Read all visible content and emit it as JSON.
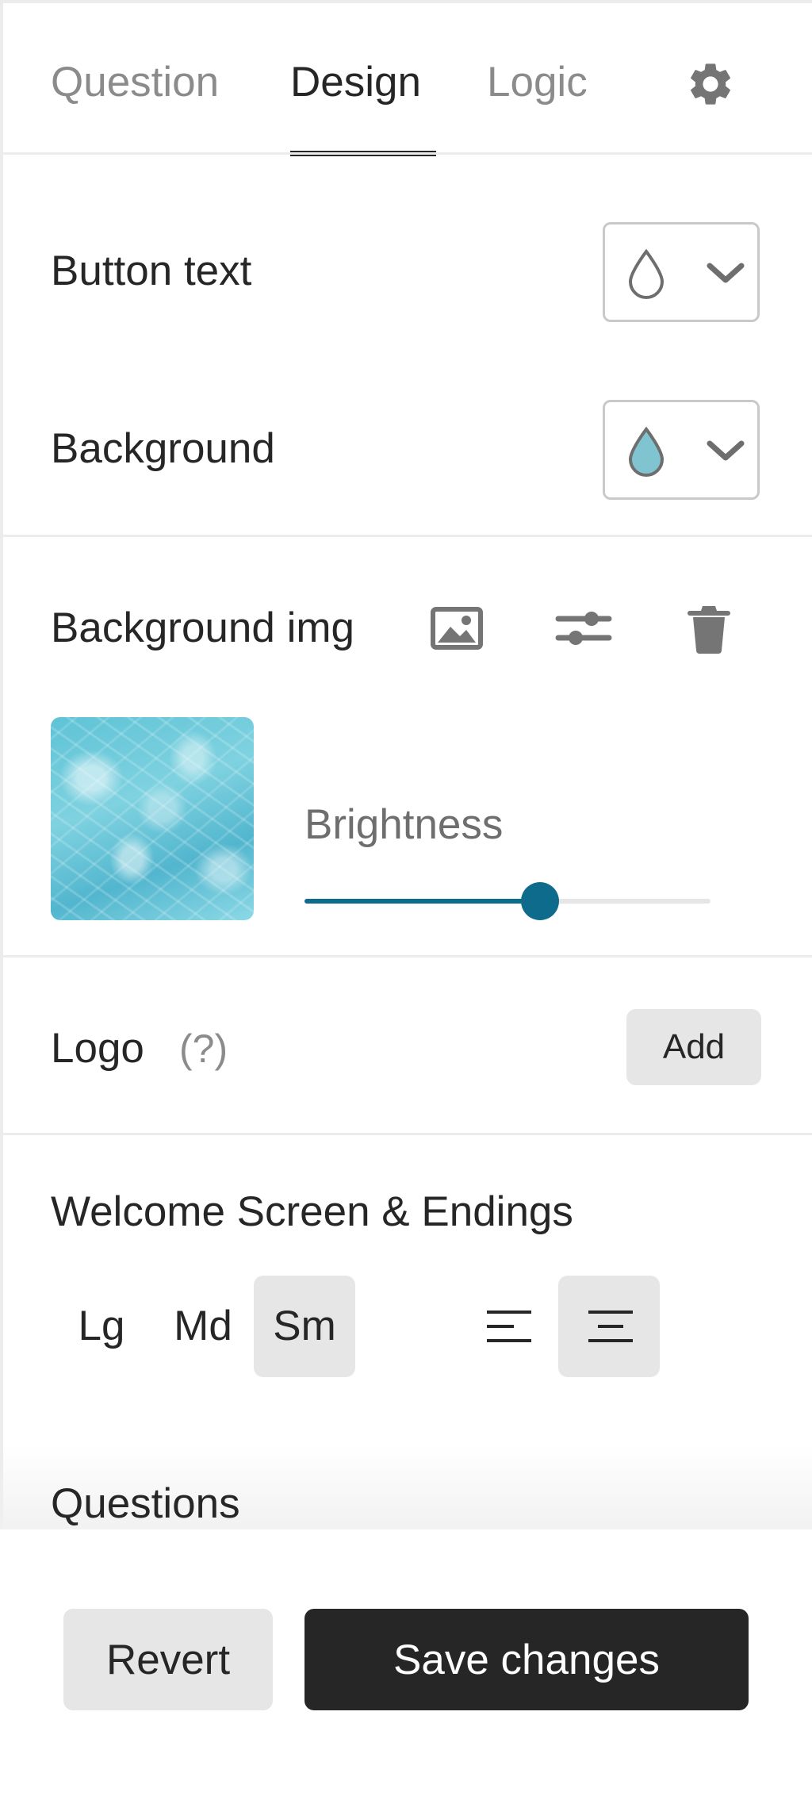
{
  "tabs": [
    {
      "label": "Question",
      "active": false
    },
    {
      "label": "Design",
      "active": true
    },
    {
      "label": "Logic",
      "active": false
    }
  ],
  "settings_icon": "gear-icon",
  "colors": {
    "button_text_label": "Button text",
    "button_text_swatch": "#ffffff",
    "background_label": "Background",
    "background_swatch": "#7fc4d0",
    "accent": "#0f6b8c"
  },
  "background_img": {
    "label": "Background img",
    "icons": [
      "image-icon",
      "sliders-icon",
      "trash-icon"
    ],
    "brightness_label": "Brightness",
    "brightness_value": 0.58
  },
  "logo": {
    "label": "Logo",
    "help": "(?)",
    "add_label": "Add"
  },
  "welcome": {
    "title": "Welcome Screen & Endings",
    "sizes": [
      "Lg",
      "Md",
      "Sm"
    ],
    "selected_size": "Sm",
    "alignments": [
      "align-left-icon",
      "align-center-icon"
    ],
    "selected_alignment": "align-center-icon"
  },
  "questions": {
    "title": "Questions"
  },
  "footer": {
    "revert_label": "Revert",
    "save_label": "Save changes"
  }
}
